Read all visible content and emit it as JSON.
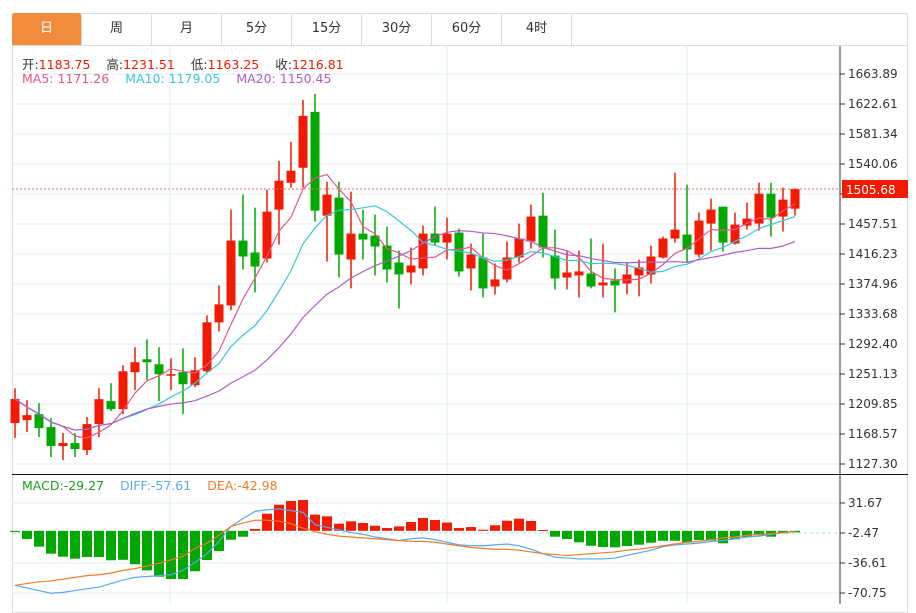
{
  "tabs": [
    {
      "label": "日",
      "active": true
    },
    {
      "label": "周"
    },
    {
      "label": "月"
    },
    {
      "label": "5分"
    },
    {
      "label": "15分"
    },
    {
      "label": "30分"
    },
    {
      "label": "60分"
    },
    {
      "label": "4时"
    }
  ],
  "ohlc_info": {
    "open_label": "开:",
    "open": "1183.75",
    "high_label": "高:",
    "high": "1231.51",
    "low_label": "低:",
    "low": "1163.25",
    "close_label": "收:",
    "close": "1216.81"
  },
  "ma_info": {
    "ma5_label": "MA5:",
    "ma5": "1171.26",
    "ma10_label": "MA10:",
    "ma10": "1179.05",
    "ma20_label": "MA20:",
    "ma20": "1150.45"
  },
  "macd_info": {
    "macd_label": "MACD:",
    "macd": "-29.27",
    "diff_label": "DIFF:",
    "diff": "-57.61",
    "dea_label": "DEA:",
    "dea": "-42.98"
  },
  "colors": {
    "up": "#f21a00",
    "down": "#00a800",
    "accent_tab": "#f28c3c",
    "ma5": "#e8558a",
    "ma10": "#3cc4d8",
    "ma20": "#b05cc8",
    "macd": "#1a9e1a",
    "diff": "#5aa8f0",
    "dea": "#f07c28",
    "value": "#f21a00"
  },
  "chart_data": {
    "type": "candlestick",
    "price_axis": {
      "ticks": [
        "1663.89",
        "1622.61",
        "1581.34",
        "1540.06",
        "1498.78",
        "1457.51",
        "1416.23",
        "1374.96",
        "1333.68",
        "1292.40",
        "1251.13",
        "1209.85",
        "1168.57",
        "1127.30"
      ],
      "ylim": [
        1127.3,
        1663.89
      ]
    },
    "last_price": "1505.68",
    "grid": true,
    "ohlc": [
      [
        1183.75,
        1231.51,
        1163.25,
        1216.81
      ],
      [
        1187.7,
        1215.1,
        1171.2,
        1194.5
      ],
      [
        1195.9,
        1211.0,
        1164.4,
        1176.7
      ],
      [
        1178.1,
        1190.4,
        1136.9,
        1152.0
      ],
      [
        1152.0,
        1169.8,
        1132.8,
        1156.1
      ],
      [
        1156.1,
        1169.8,
        1136.9,
        1147.9
      ],
      [
        1146.5,
        1191.8,
        1139.7,
        1182.2
      ],
      [
        1182.2,
        1231.6,
        1164.4,
        1216.5
      ],
      [
        1213.8,
        1238.5,
        1200.1,
        1202.8
      ],
      [
        1202.8,
        1263.2,
        1195.9,
        1254.9
      ],
      [
        1253.6,
        1287.9,
        1228.9,
        1267.3
      ],
      [
        1271.4,
        1298.9,
        1242.6,
        1267.3
      ],
      [
        1264.5,
        1287.9,
        1213.8,
        1250.8
      ],
      [
        1249.4,
        1272.8,
        1228.9,
        1250.8
      ],
      [
        1253.6,
        1286.5,
        1195.9,
        1237.1
      ],
      [
        1235.7,
        1274.2,
        1233.0,
        1256.3
      ],
      [
        1254.9,
        1331.8,
        1252.2,
        1322.2
      ],
      [
        1322.2,
        1373.0,
        1309.8,
        1346.9
      ],
      [
        1345.5,
        1477.3,
        1338.7,
        1434.7
      ],
      [
        1434.7,
        1497.9,
        1394.9,
        1412.8
      ],
      [
        1418.3,
        1480.0,
        1363.4,
        1399.0
      ],
      [
        1410.0,
        1504.7,
        1404.5,
        1474.5
      ],
      [
        1477.3,
        1544.5,
        1429.2,
        1517.1
      ],
      [
        1514.3,
        1570.6,
        1507.5,
        1530.8
      ],
      [
        1534.9,
        1628.2,
        1507.5,
        1606.3
      ],
      [
        1611.8,
        1636.5,
        1460.8,
        1475.9
      ],
      [
        1469.0,
        1515.7,
        1405.9,
        1497.9
      ],
      [
        1493.8,
        1515.7,
        1383.9,
        1415.5
      ],
      [
        1408.6,
        1502.0,
        1368.9,
        1444.3
      ],
      [
        1444.3,
        1477.3,
        1408.6,
        1436.1
      ],
      [
        1441.6,
        1470.4,
        1386.7,
        1426.5
      ],
      [
        1427.9,
        1453.9,
        1377.1,
        1394.9
      ],
      [
        1404.5,
        1421.0,
        1341.4,
        1388.1
      ],
      [
        1390.8,
        1425.1,
        1374.3,
        1400.4
      ],
      [
        1396.3,
        1455.3,
        1386.7,
        1444.3
      ],
      [
        1444.3,
        1481.4,
        1427.9,
        1432.0
      ],
      [
        1432.0,
        1466.3,
        1408.6,
        1444.3
      ],
      [
        1445.7,
        1451.2,
        1385.3,
        1392.2
      ],
      [
        1396.3,
        1430.6,
        1366.1,
        1415.5
      ],
      [
        1411.4,
        1444.3,
        1356.5,
        1368.9
      ],
      [
        1371.6,
        1403.2,
        1360.6,
        1381.2
      ],
      [
        1381.2,
        1433.4,
        1377.1,
        1411.4
      ],
      [
        1411.4,
        1458.1,
        1404.5,
        1437.5
      ],
      [
        1433.4,
        1484.1,
        1423.7,
        1467.7
      ],
      [
        1469.0,
        1500.6,
        1411.4,
        1425.1
      ],
      [
        1414.1,
        1449.8,
        1367.5,
        1382.6
      ],
      [
        1383.9,
        1419.6,
        1367.5,
        1390.8
      ],
      [
        1386.7,
        1421.0,
        1356.5,
        1392.2
      ],
      [
        1389.4,
        1437.5,
        1368.9,
        1371.6
      ],
      [
        1373.0,
        1430.6,
        1356.5,
        1377.1
      ],
      [
        1379.8,
        1396.3,
        1335.9,
        1373.0
      ],
      [
        1375.7,
        1404.5,
        1360.6,
        1388.1
      ],
      [
        1386.7,
        1408.6,
        1357.9,
        1397.7
      ],
      [
        1388.1,
        1427.9,
        1375.7,
        1412.8
      ],
      [
        1411.4,
        1440.2,
        1410.0,
        1437.5
      ],
      [
        1437.5,
        1528.0,
        1432.0,
        1449.8
      ],
      [
        1443.0,
        1511.6,
        1404.5,
        1422.4
      ],
      [
        1415.5,
        1473.2,
        1411.4,
        1462.2
      ],
      [
        1458.1,
        1492.4,
        1421.0,
        1477.3
      ],
      [
        1481.4,
        1481.4,
        1419.6,
        1432.0
      ],
      [
        1430.6,
        1473.2,
        1429.2,
        1456.7
      ],
      [
        1455.3,
        1486.9,
        1449.8,
        1464.9
      ],
      [
        1458.1,
        1514.3,
        1448.4,
        1499.2
      ],
      [
        1499.2,
        1514.3,
        1440.2,
        1466.3
      ],
      [
        1467.7,
        1507.5,
        1447.1,
        1491.0
      ],
      [
        1478.6,
        1506.1,
        1469.0,
        1505.68
      ]
    ],
    "moving_averages": [
      "MA5",
      "MA10",
      "MA20"
    ],
    "macd_axis": {
      "ticks": [
        "31.67",
        "-2.47",
        "-36.61",
        "-70.75"
      ],
      "ylim": [
        -70.75,
        31.67
      ]
    },
    "macd_hist": [
      -1,
      -9.3,
      -18,
      -26,
      -29.4,
      -31.7,
      -29.8,
      -29.8,
      -33.5,
      -33,
      -38.1,
      -45,
      -52.2,
      -54.8,
      -54.8,
      -46,
      -33.2,
      -23,
      -10.1,
      -6.7,
      2.1,
      19.5,
      29.7,
      33.9,
      35.1,
      18.4,
      16.5,
      8.1,
      10.8,
      8.9,
      5.8,
      3.2,
      5.1,
      10,
      14.6,
      12.3,
      9.4,
      3.2,
      4.3,
      1.3,
      6.3,
      11.5,
      13.8,
      11.2,
      0.9,
      -6.7,
      -9.3,
      -13.1,
      -17,
      -18.4,
      -18.8,
      -17.3,
      -15.8,
      -13.5,
      -11.3,
      -11.3,
      -13.1,
      -10.5,
      -10.9,
      -14.2,
      -9.7,
      -7.4,
      -5.1,
      -6.7,
      -2.8,
      -1.7
    ],
    "diff": [
      -62,
      -65,
      -68,
      -71,
      -70,
      -68,
      -66,
      -64,
      -60,
      -56,
      -53,
      -52,
      -51,
      -50,
      -45,
      -36,
      -26,
      -12,
      5,
      14,
      22,
      24,
      25,
      23,
      21,
      7,
      4,
      1,
      -2,
      -4,
      -7,
      -9,
      -11,
      -9,
      -8,
      -10,
      -13,
      -16,
      -17,
      -17,
      -16,
      -15,
      -17,
      -21,
      -26,
      -30,
      -31,
      -32,
      -32,
      -32,
      -31,
      -28,
      -25,
      -22,
      -18,
      -16,
      -15,
      -14,
      -12,
      -11,
      -9,
      -7,
      -6,
      -4,
      -2,
      -1
    ],
    "dea": [
      -62,
      -60,
      -58,
      -57,
      -55,
      -53,
      -51,
      -50,
      -48,
      -45,
      -43,
      -40,
      -37,
      -33,
      -29,
      -20,
      -14,
      -5,
      5,
      9,
      12,
      12,
      11,
      8,
      3,
      -1,
      -4,
      -6,
      -7,
      -8,
      -9,
      -10,
      -11,
      -12,
      -12,
      -13,
      -15,
      -17,
      -19,
      -20,
      -21,
      -21,
      -22,
      -24,
      -26,
      -27,
      -28,
      -27,
      -26,
      -25,
      -24,
      -22,
      -21,
      -19,
      -17,
      -15,
      -13,
      -12,
      -10,
      -8,
      -7,
      -5,
      -4,
      -3,
      -2,
      -1
    ]
  }
}
